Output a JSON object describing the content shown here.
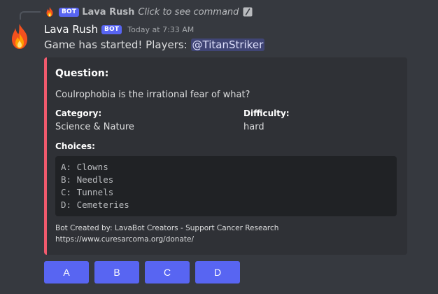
{
  "reply": {
    "bot_tag": "BOT",
    "author": "Lava Rush",
    "command_hint": "Click to see command"
  },
  "message": {
    "author": "Lava Rush",
    "bot_tag": "BOT",
    "timestamp": "Today at 7:33 AM",
    "text": "Game has started! Players: ",
    "mention": "@TitanStriker"
  },
  "embed": {
    "accent_color": "#f15a6d",
    "title": "Question:",
    "description": "Coulrophobia is the irrational fear of what?",
    "fields": {
      "category_name": "Category:",
      "category_value": "Science & Nature",
      "difficulty_name": "Difficulty:",
      "difficulty_value": "hard",
      "choices_name": "Choices:"
    },
    "choices": [
      "A: Clowns",
      "B: Needles",
      "C: Tunnels",
      "D: Cemeteries"
    ],
    "footer": [
      "Bot Created by: LavaBot Creators - Support Cancer Research",
      "https://www.curesarcoma.org/donate/"
    ]
  },
  "buttons": [
    "A",
    "B",
    "C",
    "D"
  ],
  "icons": {
    "avatar": "fire-icon",
    "reply_avatar": "fire-icon",
    "command": "slash-command-icon"
  },
  "colors": {
    "background": "#36393f",
    "embed_bg": "#2f3136",
    "blurple": "#5865f2"
  }
}
